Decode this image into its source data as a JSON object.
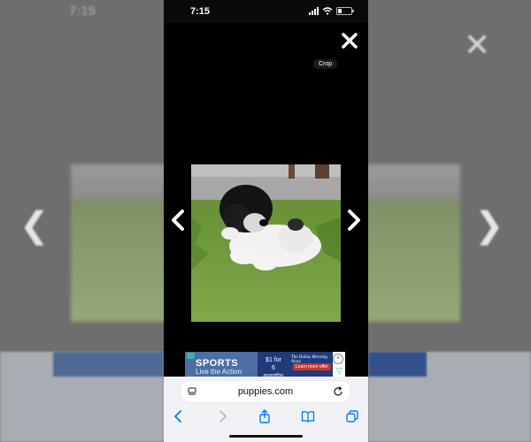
{
  "status_bar": {
    "time": "7:15"
  },
  "viewer": {
    "crop_tooltip": "Crop"
  },
  "ad": {
    "title": "SPORTS",
    "subtitle": "Live the Action",
    "price_line1": "$1 for",
    "price_line2": "6 months",
    "brand": "The Dallas Morning News",
    "cta": "Learn more offer",
    "close_glyph": "×"
  },
  "browser": {
    "url": "puppies.com"
  },
  "colors": {
    "accent": "#007aff",
    "ad_blue": "#4c6fa3",
    "ad_navy": "#1f3b7a",
    "background": "#000000"
  },
  "icons": {
    "close": "close-icon",
    "prev": "chevron-left-icon",
    "next": "chevron-right-icon",
    "back": "back-icon",
    "forward": "forward-icon",
    "share": "share-icon",
    "bookmarks": "book-icon",
    "tabs": "tabs-icon",
    "reload": "reload-icon"
  }
}
